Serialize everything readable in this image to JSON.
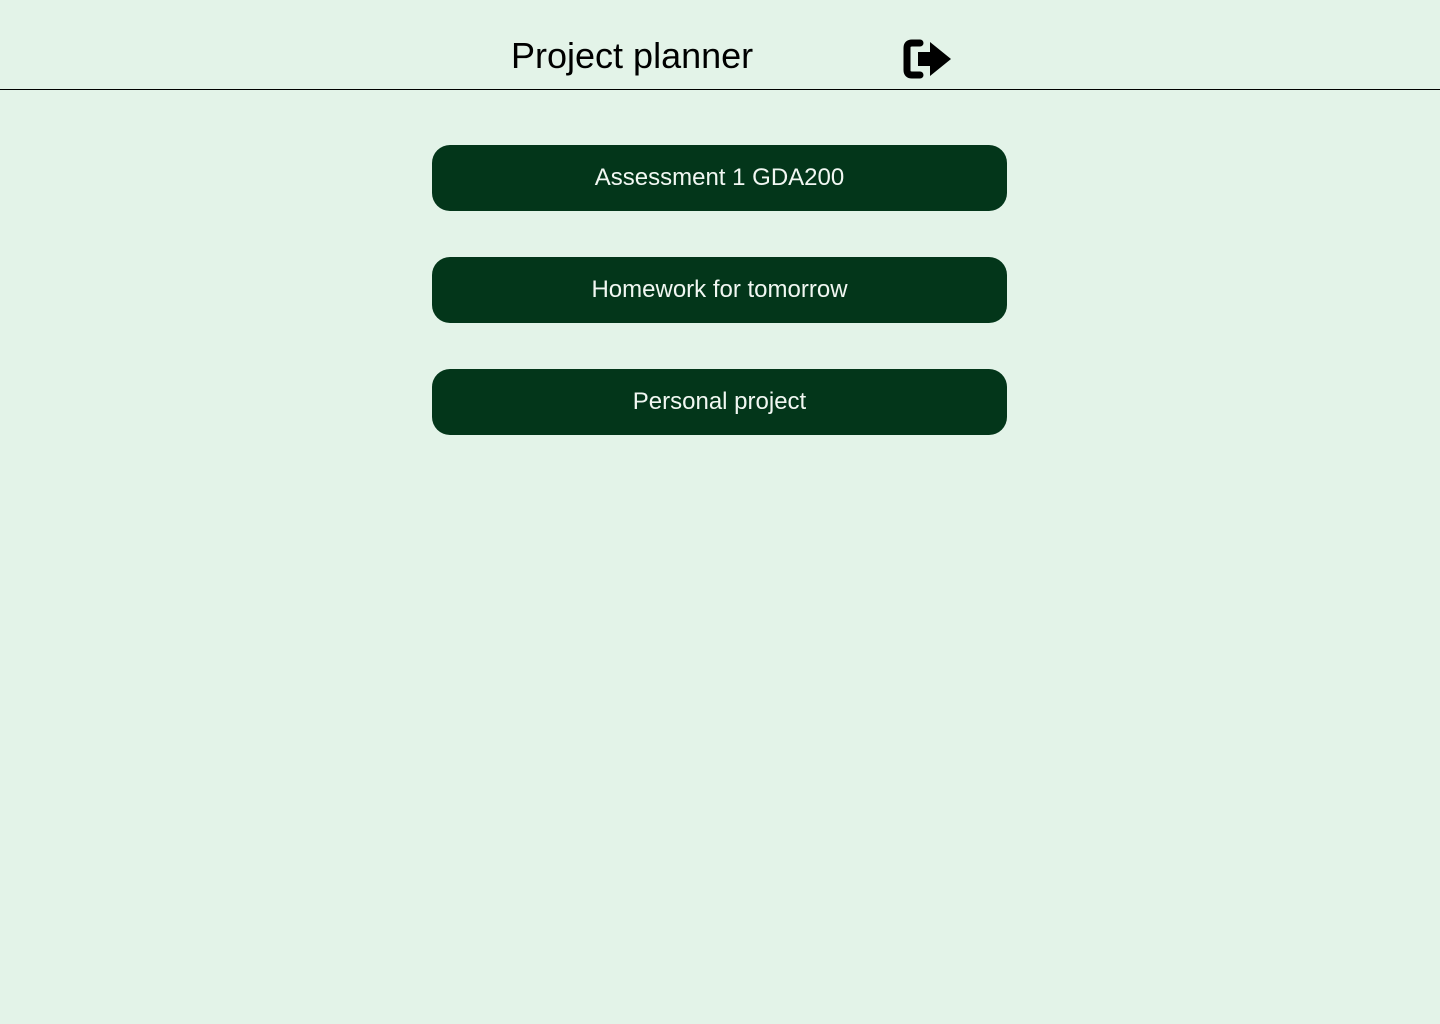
{
  "header": {
    "title": "Project planner",
    "logout_icon": "logout-icon"
  },
  "projects": [
    {
      "label": "Assessment 1 GDA200"
    },
    {
      "label": "Homework for tomorrow"
    },
    {
      "label": "Personal project"
    }
  ],
  "colors": {
    "background": "#e3f3e8",
    "button_background": "#03361a",
    "button_text": "#f1f7f2",
    "header_text": "#000000"
  }
}
